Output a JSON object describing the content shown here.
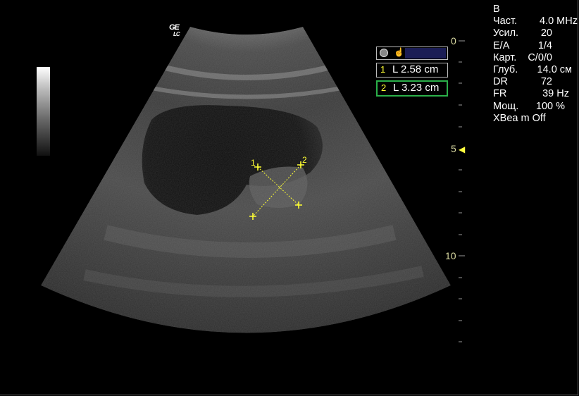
{
  "logo": {
    "brand": "GE",
    "sub": "LC"
  },
  "parameters": [
    {
      "label": "B",
      "value": ""
    },
    {
      "label": "Част.",
      "value": "4.0 MHz"
    },
    {
      "label": "Усил.",
      "value": "20"
    },
    {
      "label": "E/A",
      "value": "1/4"
    },
    {
      "label": "Карт.",
      "value": "C/0/0"
    },
    {
      "label": "Глуб.",
      "value": "14.0 cм"
    },
    {
      "label": "DR",
      "value": "72"
    },
    {
      "label": "FR",
      "value": "39 Hz"
    },
    {
      "label": "Мощ.",
      "value": "100 %"
    },
    {
      "label": "XBea m Off",
      "value": ""
    }
  ],
  "measurement_panel": {
    "header_icons": [
      "circle-marker-icon",
      "pointer-icon"
    ],
    "measurements": [
      {
        "index": "1",
        "text": "L  2.58 cm"
      },
      {
        "index": "2",
        "text": "L  3.23 cm"
      }
    ]
  },
  "depth_scale": {
    "labels": [
      "0",
      "5",
      "10"
    ],
    "focus_marker_at": "5"
  },
  "calipers": {
    "labels": [
      "1",
      "2"
    ],
    "line1_color": "#ffff33",
    "line2_color": "#ffff33"
  },
  "colors": {
    "caliper": "#ffff33",
    "active_measurement_border": "#2bb04a",
    "depth_label": "#d8d8a0"
  }
}
